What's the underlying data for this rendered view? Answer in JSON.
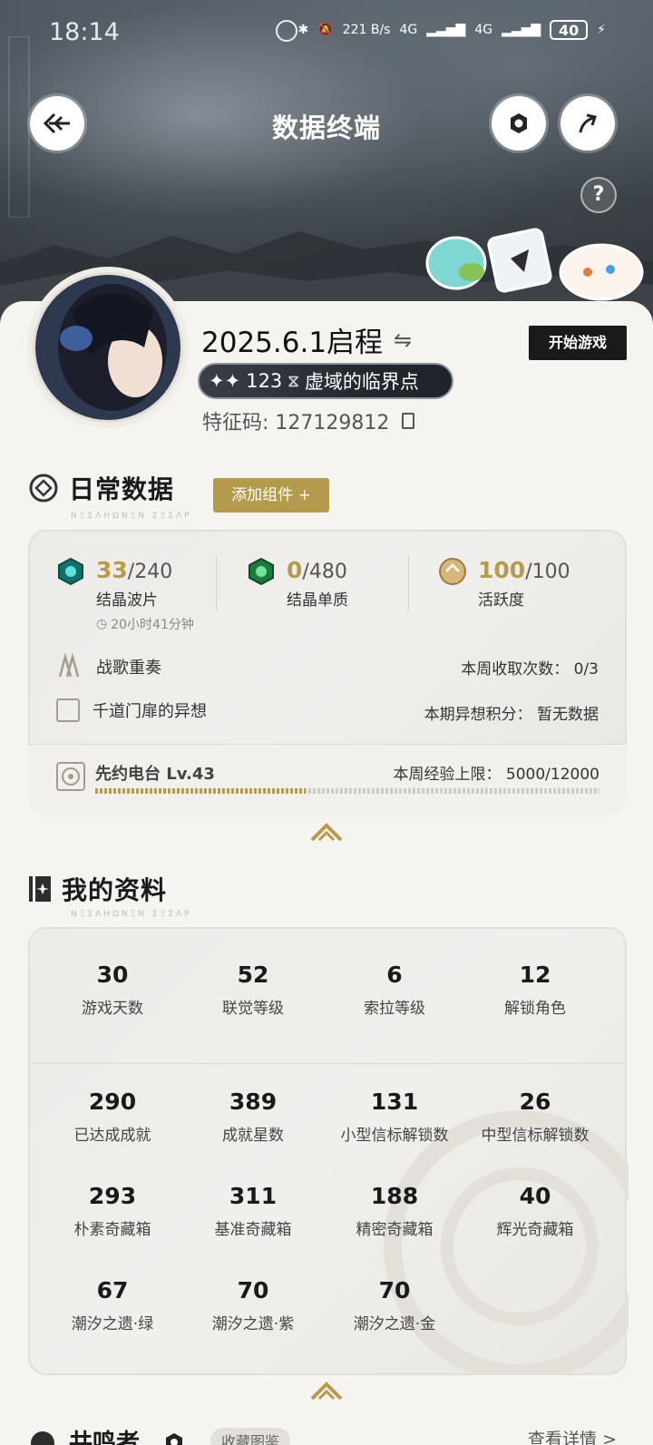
{
  "status_bar": {
    "time": "18:14",
    "net_speed": "221 B/s",
    "signal1": "4G",
    "signal2": "4G",
    "battery": "40"
  },
  "header": {
    "title": "数据终端",
    "help": "?"
  },
  "profile": {
    "name": "2025.6.1启程",
    "swap_icon": "⇋",
    "level": "123",
    "rank_title": "虚域的临界点",
    "feature_code": "特征码: 127129812",
    "start_label": "开始游戏"
  },
  "daily": {
    "title": "日常数据",
    "subtitle": "ΝΞΣΛΗΩΝΞΝ ΣΞΣΛΡ",
    "add_label": "添加组件 +",
    "crystal_wave": {
      "value": "33",
      "max": "/240",
      "label": "结晶波片",
      "timer": "20小时41分钟"
    },
    "crystal_solute": {
      "value": "0",
      "max": "/480",
      "label": "结晶单质"
    },
    "activity": {
      "value": "100",
      "max": "/100",
      "label": "活跃度"
    },
    "war_song": {
      "label": "战歌重奏",
      "right": "本周收取次数：  0/3"
    },
    "thousand_gates": {
      "label": "千道门扉的异想",
      "right": "本期异想积分：  暂无数据"
    },
    "radio": {
      "label": "先约电台 Lv.43",
      "exp": "本周经验上限：  5000/12000",
      "progress": 0.4167
    }
  },
  "profile_data": {
    "title": "我的资料",
    "subtitle": "ΝΞΣΛΗΩΝΞΝ ΣΞΣΛΡ",
    "top_stats": [
      {
        "value": "30",
        "label": "游戏天数"
      },
      {
        "value": "52",
        "label": "联觉等级"
      },
      {
        "value": "6",
        "label": "索拉等级"
      },
      {
        "value": "12",
        "label": "解锁角色"
      }
    ],
    "stats": [
      {
        "value": "290",
        "label": "已达成成就"
      },
      {
        "value": "389",
        "label": "成就星数"
      },
      {
        "value": "131",
        "label": "小型信标解锁数"
      },
      {
        "value": "26",
        "label": "中型信标解锁数"
      },
      {
        "value": "293",
        "label": "朴素奇藏箱"
      },
      {
        "value": "311",
        "label": "基准奇藏箱"
      },
      {
        "value": "188",
        "label": "精密奇藏箱"
      },
      {
        "value": "40",
        "label": "辉光奇藏箱"
      },
      {
        "value": "67",
        "label": "潮汐之遗·绿"
      },
      {
        "value": "70",
        "label": "潮汐之遗·紫"
      },
      {
        "value": "70",
        "label": "潮汐之遗·金"
      }
    ]
  },
  "resonators": {
    "title": "共鸣者",
    "tag": "收藏图鉴",
    "more": "查看详情 >"
  },
  "colors": {
    "gold": "#b89a4c",
    "dark": "#1a1a1a",
    "sheet": "#f6f4f1"
  }
}
